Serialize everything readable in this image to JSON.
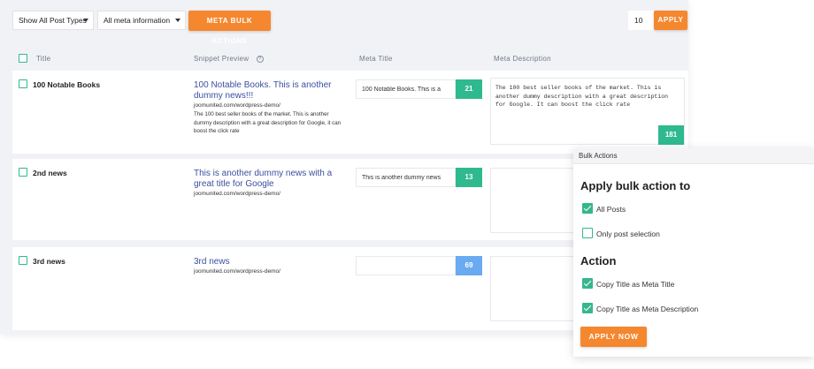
{
  "toolbar": {
    "post_types_select": "Show All Post Types",
    "meta_info_select": "All meta information",
    "meta_bulk_label": "META BULK ACTIONS",
    "per_page_value": "10",
    "apply_label": "APPLY"
  },
  "table": {
    "columns": [
      "Title",
      "Snippet Preview",
      "Meta Title",
      "Meta Description"
    ],
    "rows": [
      {
        "title": "100 Notable Books",
        "snippet_title": "100 Notable Books. This is another dummy news!!!",
        "snippet_url": "joomunited.com/wordpress-demo/",
        "snippet_desc": "The 100 best seller books of the market. This is another dummy description with a great description for Google, it can boost the click rate",
        "meta_title": "100 Notable Books. This is a",
        "meta_title_count": "21",
        "meta_desc": "The 100 best seller books of the market. This is another dummy description with a great description for Google. It can boost the click rate",
        "meta_desc_count": "181"
      },
      {
        "title": "2nd news",
        "snippet_title": "This is another dummy news with a great title for Google",
        "snippet_url": "joomunited.com/wordpress-demo/",
        "snippet_desc": "",
        "meta_title": "This is another dummy news",
        "meta_title_count": "13",
        "meta_desc": "",
        "meta_desc_count": ""
      },
      {
        "title": "3rd news",
        "snippet_title": "3rd news",
        "snippet_url": "joomunited.com/wordpress-demo/",
        "snippet_desc": "",
        "meta_title": "",
        "meta_title_count": "69",
        "meta_desc": "",
        "meta_desc_count": ""
      }
    ]
  },
  "bulk": {
    "header": "Bulk Actions",
    "apply_to_heading": "Apply bulk action to",
    "opt_all_posts": "All Posts",
    "opt_selection": "Only post selection",
    "action_heading": "Action",
    "opt_copy_meta_title": "Copy Title as Meta Title",
    "opt_copy_meta_desc": "Copy Title as Meta Description",
    "apply_now_label": "APPLY NOW"
  },
  "colors": {
    "accent_orange": "#f5872f",
    "green": "#2fb98e",
    "blue_badge": "#6aaaf0",
    "link_blue": "#3b4fa0"
  }
}
